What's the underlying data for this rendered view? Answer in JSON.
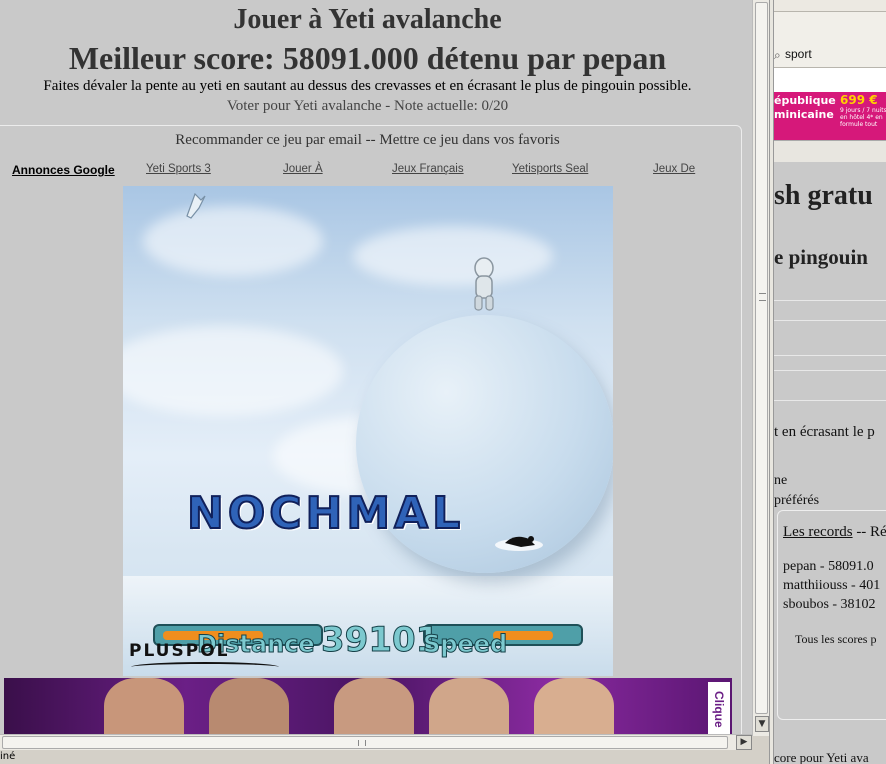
{
  "header": {
    "title": "Jouer à Yeti avalanche",
    "best_score": "Meilleur score: 58091.000 détenu par pepan",
    "description": "Faites dévaler la pente au yeti en sautant au dessus des crevasses et en écrasant le plus de pingouin possible.",
    "vote_link": "Voter pour Yeti avalanche",
    "vote_rating": " - Note actuelle: 0/20"
  },
  "recommend": {
    "email_link": "Recommander ce jeu par email",
    "separator": " -- ",
    "favorites_link": "Mettre ce jeu dans vos favoris"
  },
  "ad_links": {
    "label": "Annonces Google",
    "items": [
      "Yeti Sports 3",
      "Jouer À",
      "Jeux Français",
      "Yetisports Seal",
      "Jeux De"
    ]
  },
  "game": {
    "overlay_text": "NOCHMAL",
    "hud_distance_label": "Distance",
    "hud_distance_value": "39101",
    "hud_speed_label": "Speed",
    "brand": "PLUSPOL"
  },
  "banner": {
    "cta": "Clique"
  },
  "status_bar": {
    "text": "iné"
  },
  "scrollbars": {
    "down_arrow": "▼",
    "right_arrow": "▶"
  },
  "right_window": {
    "search_icon": "magnifier-icon",
    "search_text": "sport",
    "ad_line1": "épublique",
    "ad_line2": "minicaine",
    "ad_price": "699 €",
    "ad_small": "9 jours / 7 nuits en hôtel 4* en formule tout",
    "heading1": "sh gratu",
    "heading2": "e pingouin",
    "desc_fragment": "t en écrasant le p",
    "fragment1": "ne",
    "fragment2": "préférés",
    "records_link": "Les records",
    "records_suffix": " -- Ré",
    "scores": [
      "pepan - 58091.0",
      "matthiiouss - 401",
      "sboubos - 38102"
    ],
    "all_scores": "Tous les scores p",
    "footer": "core pour Yeti ava"
  },
  "colors": {
    "page_bg": "#c9c9c9",
    "title_text": "#333333",
    "overlay_text_fill": "#2f63b8",
    "banner_bg": "#6b1f86",
    "right_ad_bg": "#d6187a"
  }
}
